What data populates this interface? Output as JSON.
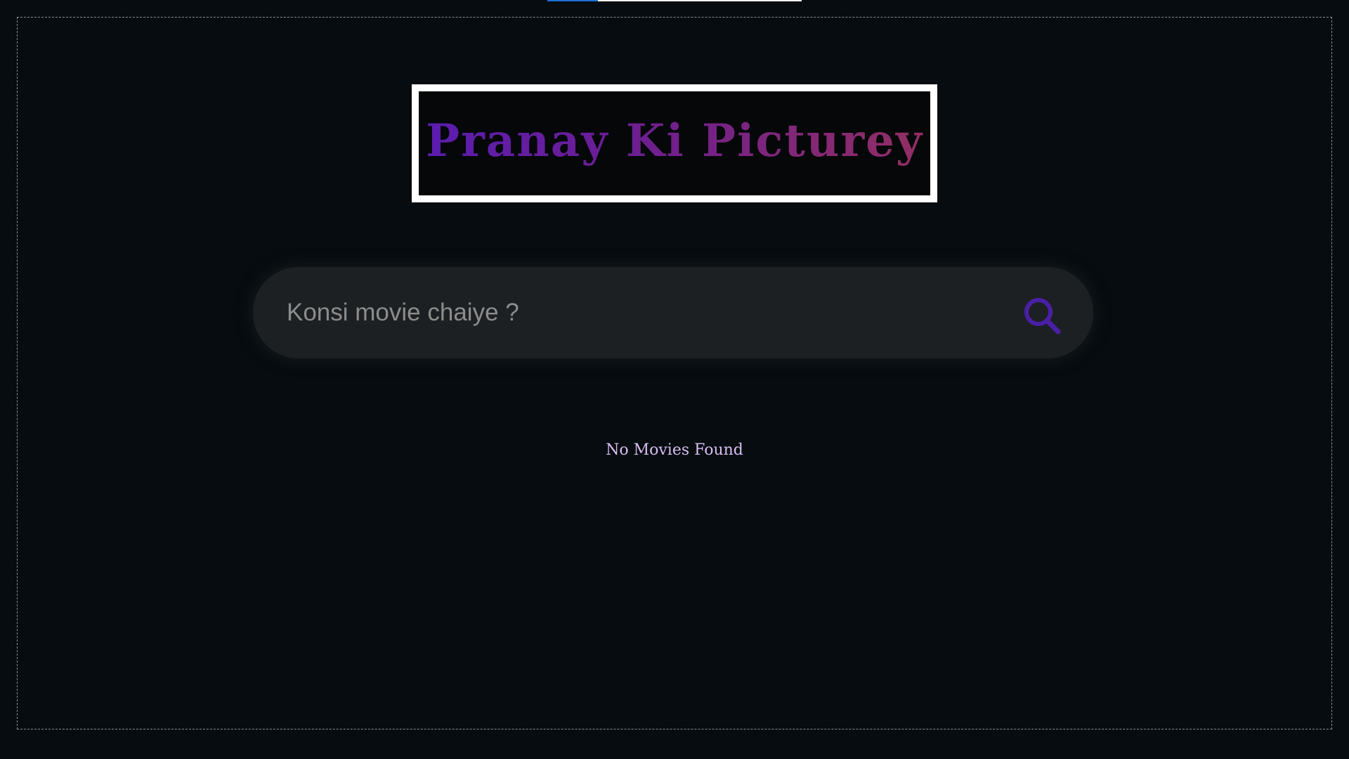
{
  "page": {
    "title": "Pranay Ki Picturey",
    "title_gradient": [
      "#5b1caf",
      "#922e63"
    ],
    "background_color": "#060c0f"
  },
  "loading_bar": {
    "progress": 0.2
  },
  "search": {
    "placeholder": "Konsi movie chaiye ?",
    "value": "",
    "icon": "search-icon",
    "icon_color": "#4a1fa6"
  },
  "results": {
    "message": "No Movies Found",
    "message_color": "#d9bdf2"
  }
}
